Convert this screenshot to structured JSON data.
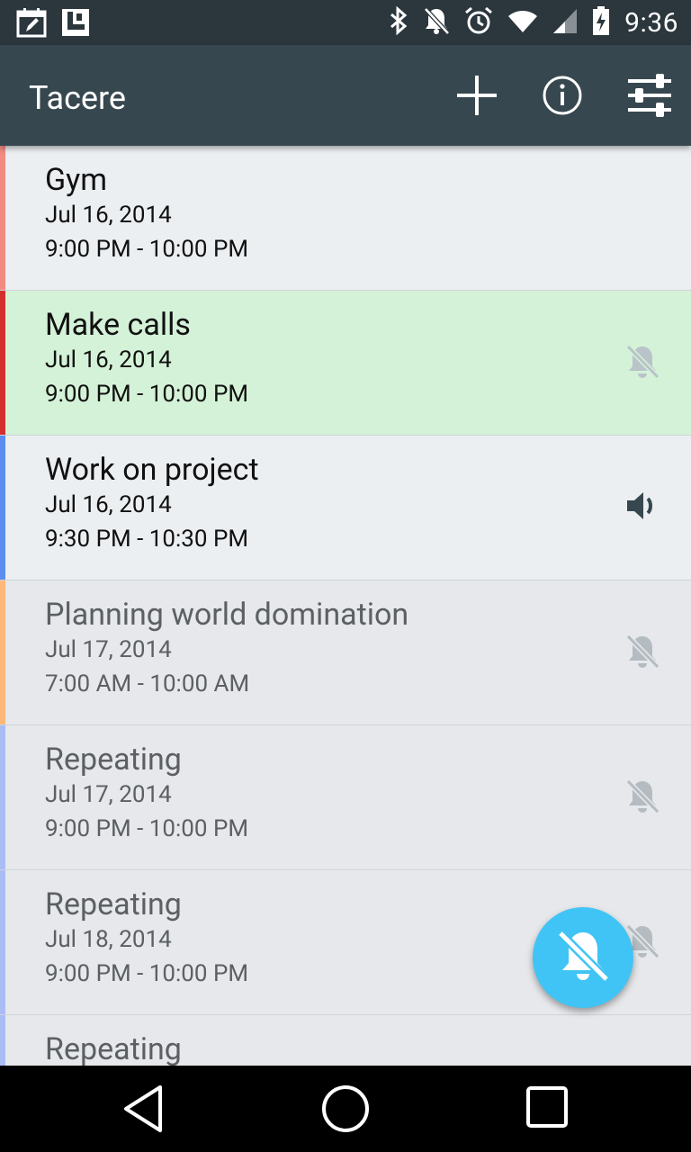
{
  "status": {
    "time": "9:36",
    "left_icons": [
      "calendar-edit-icon",
      "launcher-icon"
    ],
    "right_icons": [
      "bluetooth-icon",
      "notifications-off-icon",
      "alarm-icon",
      "wifi-icon",
      "signal-icon",
      "battery-charging-icon"
    ]
  },
  "appbar": {
    "title": "Tacere",
    "actions": [
      "add-icon",
      "info-icon",
      "settings-sliders-icon"
    ],
    "color": "#37474f"
  },
  "events": [
    {
      "title": "Gym",
      "date": "Jul 16, 2014",
      "time": "9:00 PM - 10:00 PM",
      "bar_color": "#f28b82",
      "bg": "#eceff1",
      "icon": "",
      "past": false
    },
    {
      "title": "Make calls",
      "date": "Jul 16, 2014",
      "time": "9:00 PM - 10:00 PM",
      "bar_color": "#d32f2f",
      "bg": "#d4f2d7",
      "icon": "bell-off-icon",
      "past": false
    },
    {
      "title": "Work on project",
      "date": "Jul 16, 2014",
      "time": "9:30 PM - 10:30 PM",
      "bar_color": "#5b8def",
      "bg": "#eceff1",
      "icon": "volume-icon",
      "past": false
    },
    {
      "title": "Planning world domination",
      "date": "Jul 17, 2014",
      "time": "7:00 AM - 10:00 AM",
      "bar_color": "#ffb878",
      "bg": "#e6e8eb",
      "icon": "bell-off-icon",
      "past": true
    },
    {
      "title": "Repeating",
      "date": "Jul 17, 2014",
      "time": "9:00 PM - 10:00 PM",
      "bar_color": "#aabcf5",
      "bg": "#e6e8eb",
      "icon": "bell-off-icon",
      "past": true
    },
    {
      "title": "Repeating",
      "date": "Jul 18, 2014",
      "time": "9:00 PM - 10:00 PM",
      "bar_color": "#aabcf5",
      "bg": "#e6e8eb",
      "icon": "bell-off-icon",
      "past": true
    },
    {
      "title": "Repeating",
      "date": "",
      "time": "",
      "bar_color": "#aabcf5",
      "bg": "#e6e8eb",
      "icon": "",
      "past": true
    }
  ],
  "fab": {
    "icon": "bell-off-icon",
    "color": "#40c4f5"
  },
  "navbar": {
    "icons": [
      "back-icon",
      "home-icon",
      "recents-icon"
    ]
  }
}
